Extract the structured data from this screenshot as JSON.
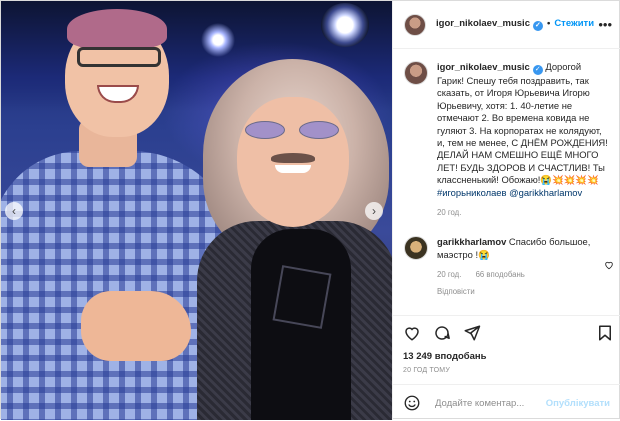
{
  "post": {
    "author": "igor_nikolaev_music",
    "follow_label": "Стежити",
    "dot": "•",
    "more": "•••"
  },
  "carousel": {
    "prev": "‹",
    "next": "›"
  },
  "caption": {
    "author": "igor_nikolaev_music",
    "text_part1": "Дорогой Гарик! Спешу тебя поздравить, так сказать, от Игоря Юрьевича Игорю Юрьевичу, хотя: 1. 40-летие не отмечают 2. Во времена ковида не гуляют 3. На корпоратах не колядуют, и, тем не менее, С ДНЁМ РОЖДЕНИЯ! ДЕЛАЙ НАМ СМЕШНО ЕЩЁ МНОГО ЛЕТ! БУДЬ ЗДОРОВ И СЧАСТЛИВ! Ты классненький! Обожаю!😭💥💥💥💥",
    "hashtag": "#игорьниколаев",
    "mention": "@garikkharlamov",
    "time": "20 год."
  },
  "reply_comment": {
    "author": "garikkharlamov",
    "text": "Спасибо большое, маэстро !😭",
    "time": "20 год.",
    "likes": "66 вподобань",
    "reply_label": "Відповісти"
  },
  "actions": {
    "likes": "13 249 вподобань",
    "time_ago": "20 ГОД ТОМУ"
  },
  "add_comment": {
    "placeholder": "Додайте коментар...",
    "publish_label": "Опублікувати"
  },
  "colors": {
    "link": "#0095f6",
    "verified": "#3897f0",
    "hashtag": "#00376b",
    "publish_disabled": "#b2dffc"
  }
}
